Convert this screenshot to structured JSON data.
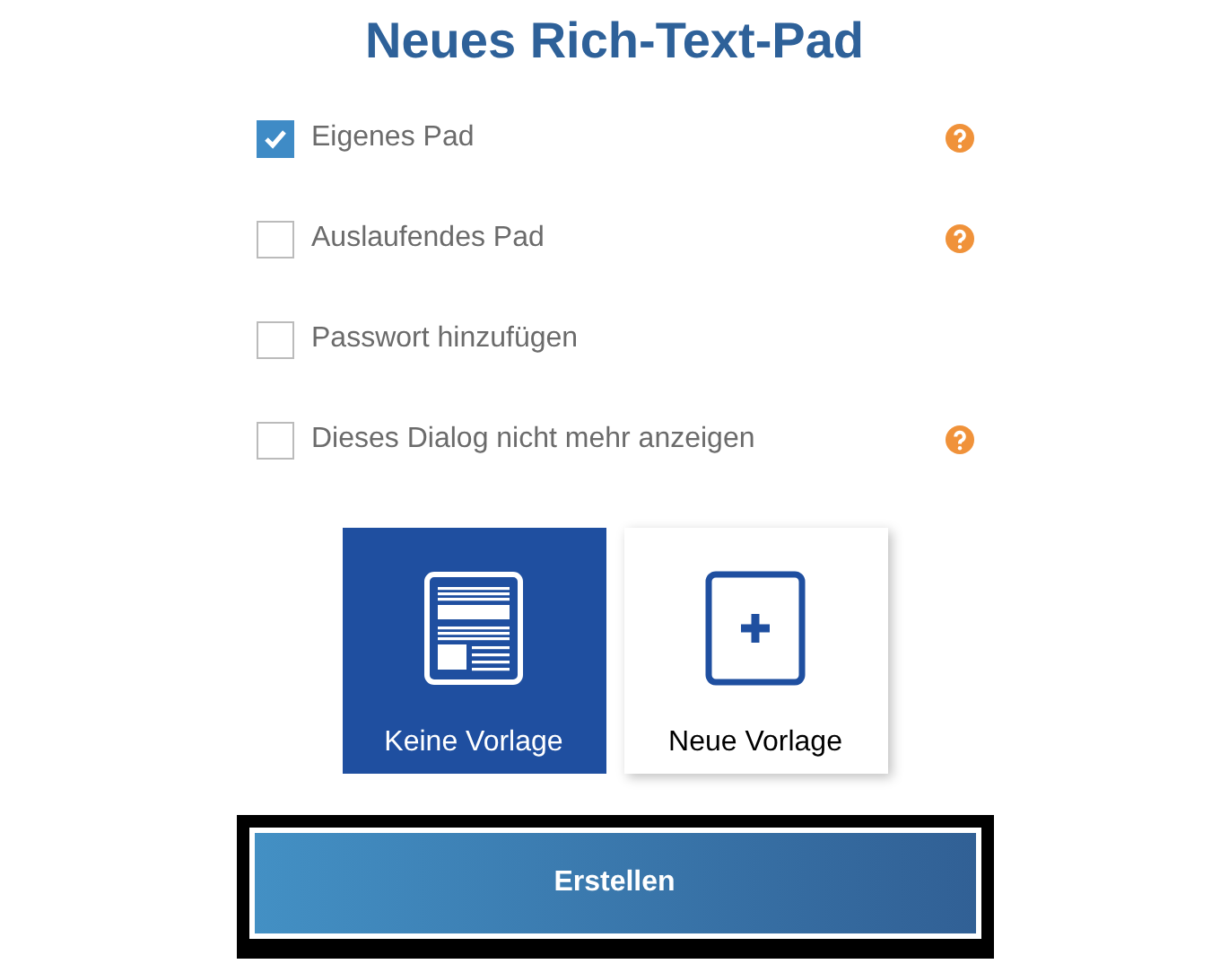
{
  "title": "Neues Rich-Text-Pad",
  "options": [
    {
      "label": "Eigenes Pad",
      "checked": true,
      "help": true
    },
    {
      "label": "Auslaufendes Pad",
      "checked": false,
      "help": true
    },
    {
      "label": "Passwort hinzufügen",
      "checked": false,
      "help": false
    },
    {
      "label": "Dieses Dialog nicht mehr anzeigen",
      "checked": false,
      "help": true
    }
  ],
  "templates": [
    {
      "kind": "document",
      "label": "Keine Vorlage",
      "selected": true
    },
    {
      "kind": "new",
      "label": "Neue Vorlage",
      "selected": false
    }
  ],
  "submit": "Erstellen"
}
